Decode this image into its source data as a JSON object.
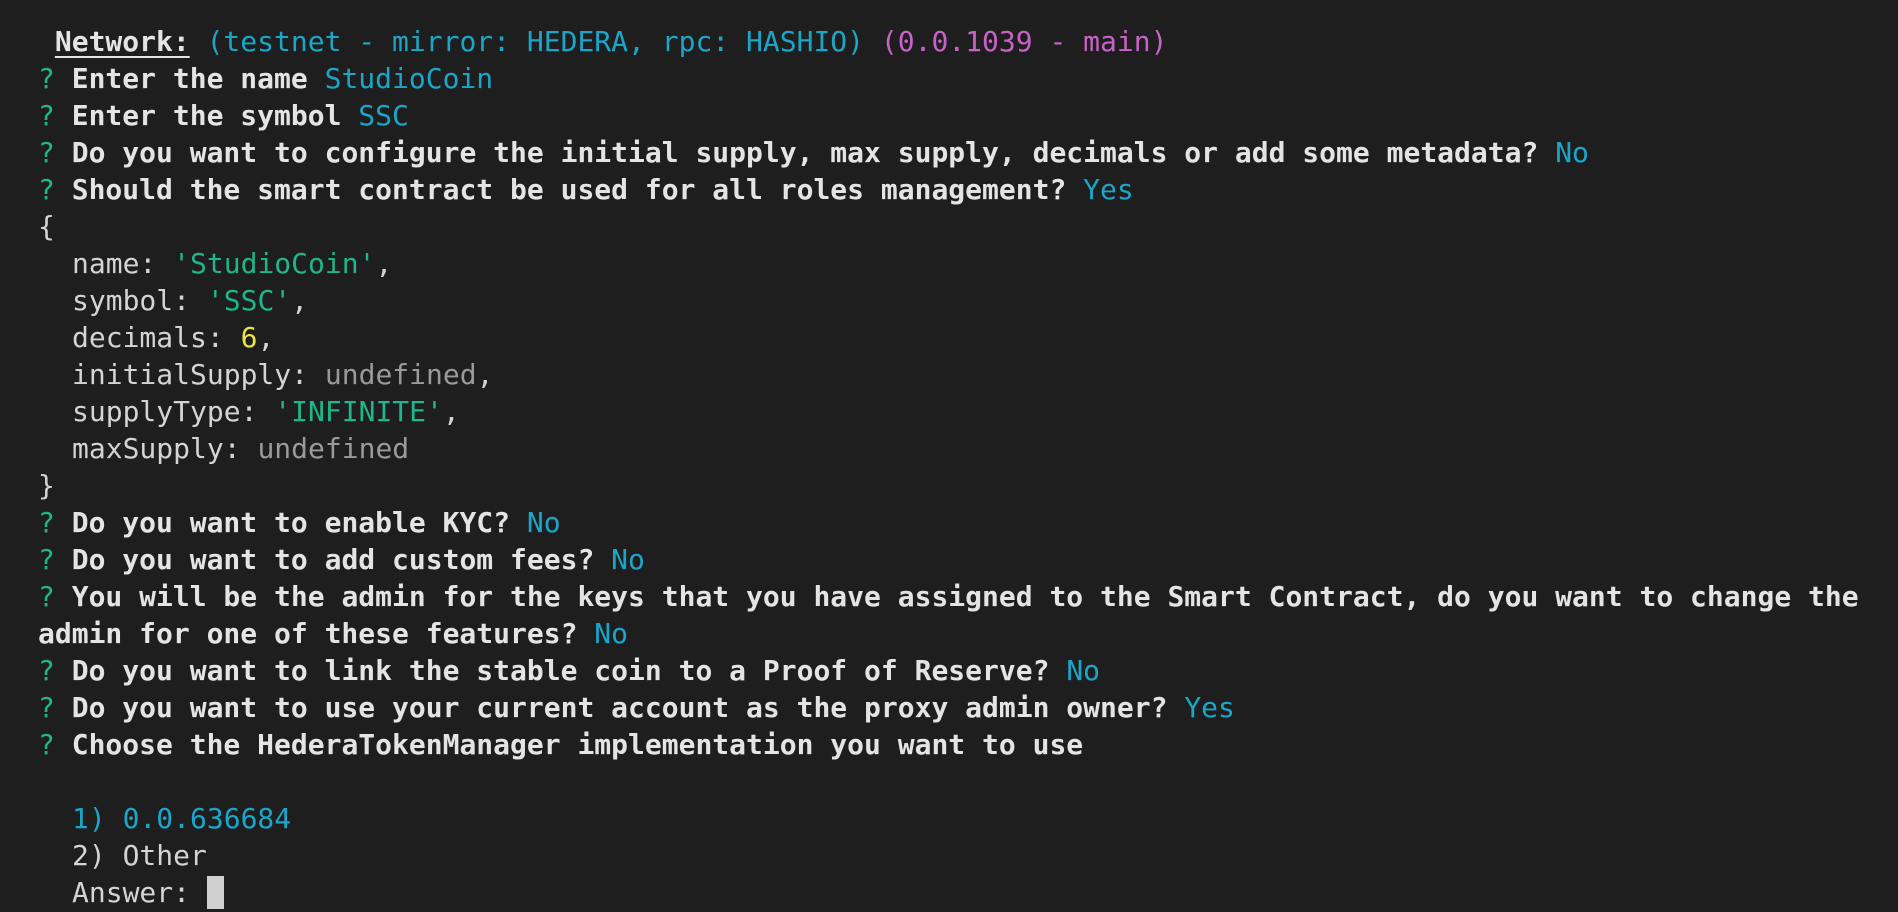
{
  "network": {
    "label": "Network:",
    "env": "(testnet - mirror: HEDERA, rpc: HASHIO)",
    "account": "(0.0.1039 - main)"
  },
  "prompt_marker": "?",
  "questions": [
    {
      "text": "Enter the name",
      "answer": "StudioCoin"
    },
    {
      "text": "Enter the symbol",
      "answer": "SSC"
    },
    {
      "text": "Do you want to configure the initial supply, max supply, decimals or add some metadata?",
      "answer": "No"
    },
    {
      "text": "Should the smart contract be used for all roles management?",
      "answer": "Yes"
    }
  ],
  "config_object": {
    "open": "{",
    "close": "}",
    "name_key": "name:",
    "name_value": "'StudioCoin'",
    "symbol_key": "symbol:",
    "symbol_value": "'SSC'",
    "decimals_key": "decimals:",
    "decimals_value": "6",
    "initialSupply_key": "initialSupply:",
    "initialSupply_value": "undefined",
    "supplyType_key": "supplyType:",
    "supplyType_value": "'INFINITE'",
    "maxSupply_key": "maxSupply:",
    "maxSupply_value": "undefined",
    "comma": ","
  },
  "questions2": [
    {
      "text": "Do you want to enable KYC?",
      "answer": "No"
    },
    {
      "text": "Do you want to add custom fees?",
      "answer": "No"
    },
    {
      "text_line1": "You will be the admin for the keys that you have assigned to the Smart Contract, do you want to change the",
      "text_line2": "admin for one of these features?",
      "answer": "No"
    },
    {
      "text": "Do you want to link the stable coin to a Proof of Reserve?",
      "answer": "No"
    },
    {
      "text": "Do you want to use your current account as the proxy admin owner?",
      "answer": "Yes"
    },
    {
      "text": "Choose the HederaTokenManager implementation you want to use"
    }
  ],
  "choices": [
    {
      "label": "1) 0.0.636684"
    },
    {
      "label": "2) Other"
    }
  ],
  "answer_prompt": "Answer:"
}
